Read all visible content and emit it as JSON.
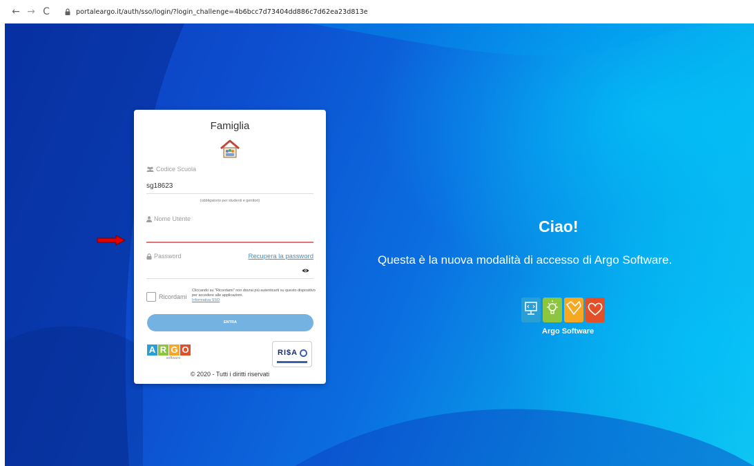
{
  "browser": {
    "back_icon": "back-arrow-icon",
    "forward_icon": "forward-arrow-icon",
    "reload_icon": "reload-icon",
    "url": "portaleargo.it/auth/sso/login/?login_challenge=4b6bcc7d73404dd886c7d62ea23d813e"
  },
  "login_card": {
    "title": "Famiglia",
    "school_code": {
      "label": "Codice Scuola",
      "value": "sg18623",
      "hint": "(obbligatorio per studenti e genitori)"
    },
    "username": {
      "label": "Nome Utente",
      "value": ""
    },
    "password": {
      "label": "Password",
      "value": "",
      "recover_link": "Recupera la password"
    },
    "remember": {
      "label": "Ricordami",
      "description": "Cliccando su \"Ricordami\" non dovrai più autenticarti su questo dispositivo per accedere alle applicazioni.",
      "link": "Informativa SSO"
    },
    "submit_label": "ENTRA",
    "argo_logo": {
      "letters": [
        "A",
        "R",
        "G",
        "O"
      ],
      "letter_colors": [
        "#2a9fd6",
        "#8cc63f",
        "#f7a823",
        "#e2502a"
      ],
      "subtitle": "software"
    },
    "risa_logo_text": "RI$A",
    "copyright": "© 2020 - Tutti i diritti riservati"
  },
  "hero": {
    "greeting": "Ciao!",
    "tagline": "Questa è la nuova modalità di accesso di Argo Software.",
    "brand_name": "Argo Software",
    "tile_colors": [
      "#2a9fd6",
      "#8cc63f",
      "#f7a823",
      "#e2502a"
    ]
  },
  "colors": {
    "accent_blue": "#0d4fd0",
    "link": "#4a90c2",
    "button": "#74b2e2",
    "active_underline": "#e57373",
    "arrow": "#e00000"
  }
}
